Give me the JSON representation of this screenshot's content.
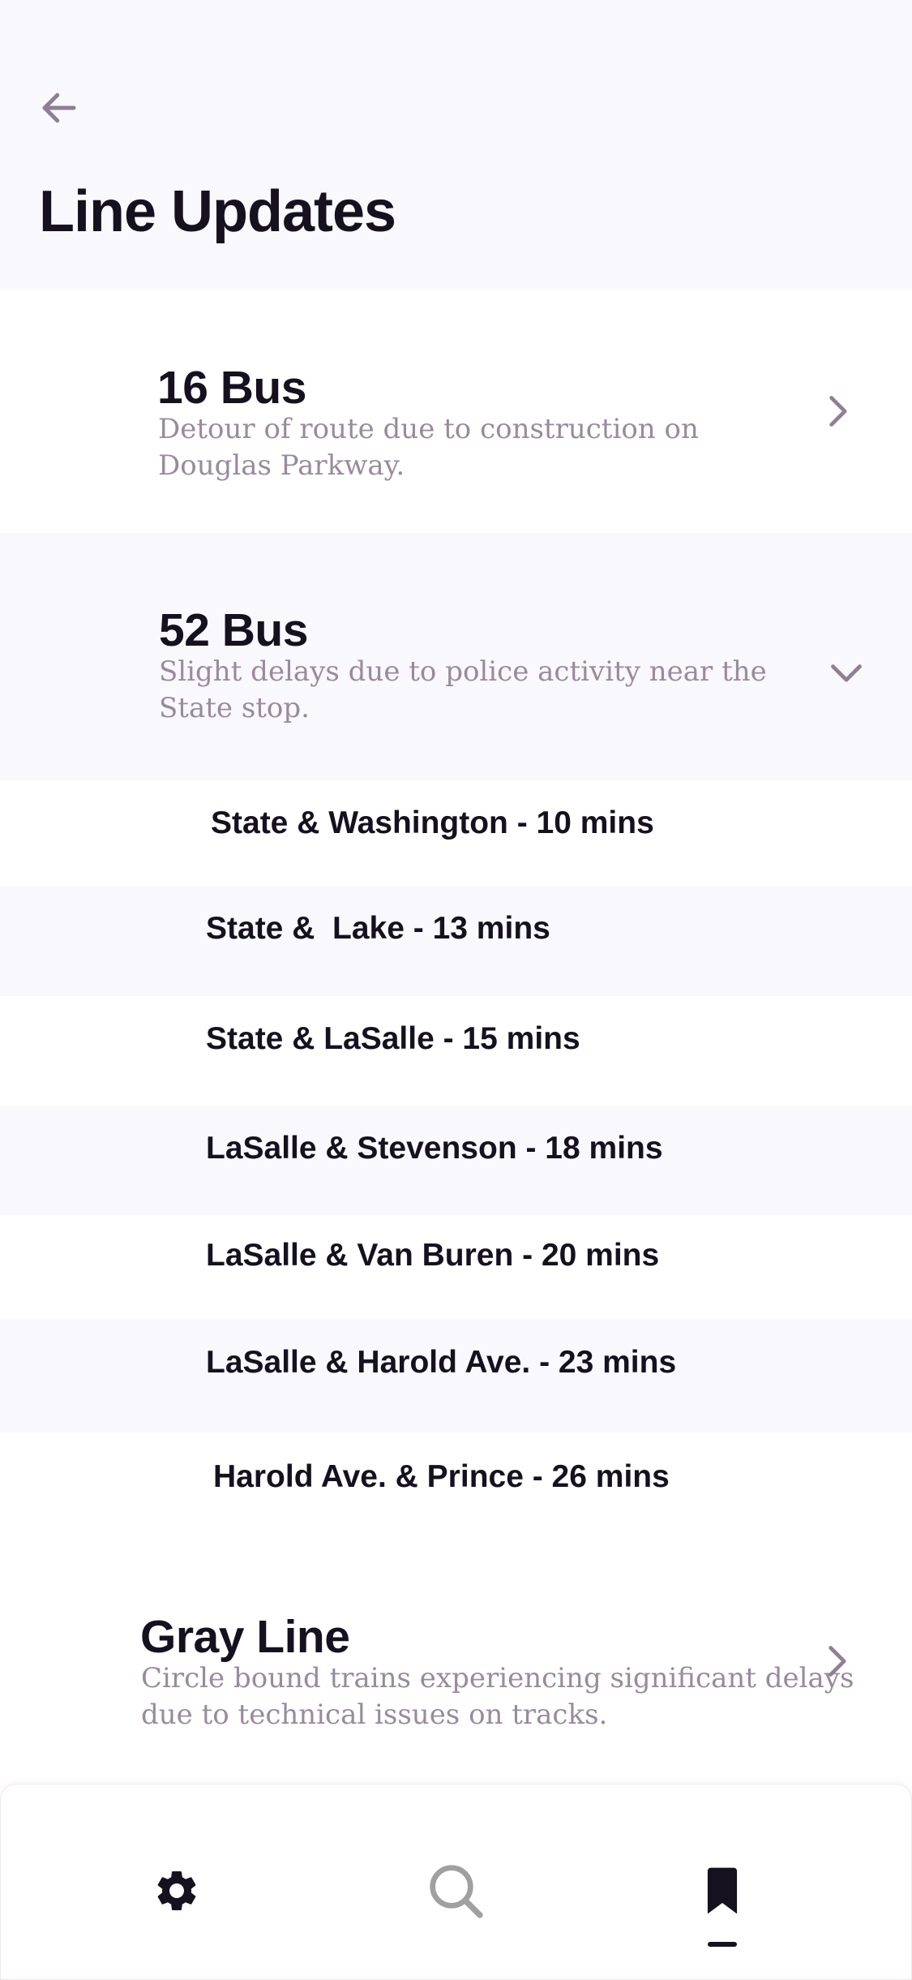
{
  "header": {
    "title": "Line Updates",
    "back_icon": "arrow-left-icon"
  },
  "updates": [
    {
      "title": "16 Bus",
      "description_lines": [
        "Detour of route due to construction on",
        "Douglas Parkway."
      ],
      "icon": "chevron-right-icon",
      "expanded": false
    },
    {
      "title": "52 Bus",
      "description_lines": [
        "Slight delays due to police activity near the",
        "State stop."
      ],
      "icon": "chevron-down-icon",
      "expanded": true,
      "stops": [
        "State & Washington - 10 mins",
        "State &  Lake - 13 mins",
        "State & LaSalle - 15 mins",
        "LaSalle & Stevenson - 18 mins",
        "LaSalle & Van Buren - 20 mins",
        "LaSalle & Harold Ave. - 23 mins",
        "Harold Ave. & Prince - 26 mins"
      ]
    },
    {
      "title": "Gray Line",
      "description_lines": [
        "Circle bound trains experiencing significant delays",
        "due to technical issues on tracks."
      ],
      "icon": "chevron-right-icon",
      "expanded": false
    }
  ],
  "bottom_nav": {
    "items": [
      {
        "icon": "gear-icon",
        "active": false
      },
      {
        "icon": "search-icon",
        "active": false
      },
      {
        "icon": "bookmark-icon",
        "active": true
      }
    ]
  },
  "colors": {
    "background_alt": "#f8f8fd",
    "text_primary": "#15111f",
    "text_secondary": "#9a8a9d",
    "icon_accent": "#8f7f94"
  }
}
